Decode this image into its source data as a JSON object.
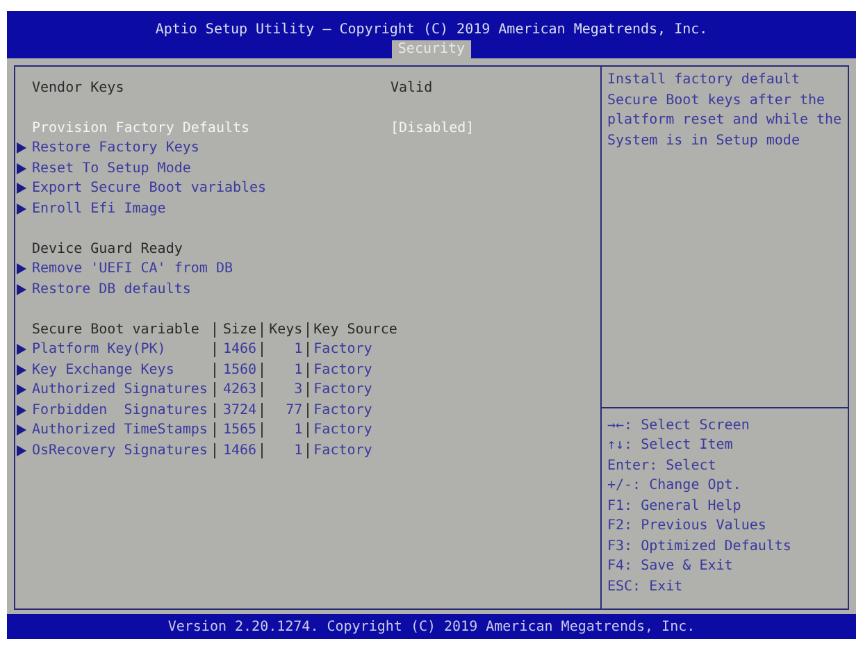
{
  "header": {
    "title": "Aptio Setup Utility – Copyright (C) 2019 American Megatrends, Inc."
  },
  "tabs": [
    {
      "label": "Security",
      "selected": true
    }
  ],
  "groups": [
    {
      "items": [
        {
          "kind": "label",
          "label": "Vendor Keys",
          "value": "Valid"
        }
      ]
    },
    {
      "items": [
        {
          "kind": "option",
          "label": "Provision Factory Defaults",
          "value": "[Disabled]",
          "selected": true
        },
        {
          "kind": "submenu",
          "label": "Restore Factory Keys",
          "selected": false
        },
        {
          "kind": "submenu",
          "label": "Reset To Setup Mode",
          "selected": false
        },
        {
          "kind": "submenu",
          "label": "Export Secure Boot variables",
          "selected": false
        },
        {
          "kind": "submenu",
          "label": "Enroll Efi Image",
          "selected": false
        }
      ]
    },
    {
      "items": [
        {
          "kind": "label",
          "label": "Device Guard Ready"
        },
        {
          "kind": "submenu",
          "label": "Remove 'UEFI CA' from DB",
          "selected": false
        },
        {
          "kind": "submenu",
          "label": "Restore DB defaults",
          "selected": false
        }
      ]
    }
  ],
  "table": {
    "columns": [
      "Secure Boot variable",
      "Size",
      "Keys",
      "Key Source"
    ],
    "rows": [
      {
        "name": "Platform Key(PK)",
        "size": "1466",
        "keys": "1",
        "source": "Factory",
        "selected": false
      },
      {
        "name": "Key Exchange Keys",
        "size": "1560",
        "keys": "1",
        "source": "Factory",
        "selected": false
      },
      {
        "name": "Authorized Signatures",
        "size": "4263",
        "keys": "3",
        "source": "Factory",
        "selected": false
      },
      {
        "name": "Forbidden  Signatures",
        "size": "3724",
        "keys": "77",
        "source": "Factory",
        "selected": false
      },
      {
        "name": "Authorized TimeStamps",
        "size": "1565",
        "keys": "1",
        "source": "Factory",
        "selected": false
      },
      {
        "name": "OsRecovery Signatures",
        "size": "1466",
        "keys": "1",
        "source": "Factory",
        "selected": false
      }
    ]
  },
  "help": {
    "text": "Install factory default Secure Boot keys after the platform reset and while the System is in Setup mode"
  },
  "keys": [
    "→←: Select Screen",
    "↑↓: Select Item",
    "Enter: Select",
    "+/-: Change Opt.",
    "F1: General Help",
    "F2: Previous Values",
    "F3: Optimized Defaults",
    "F4: Save & Exit",
    "ESC: Exit"
  ],
  "footer": {
    "text": "Version 2.20.1274. Copyright (C) 2019 American Megatrends, Inc."
  }
}
